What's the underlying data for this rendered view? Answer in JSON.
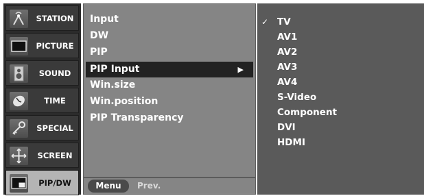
{
  "categories": [
    {
      "label": "STATION",
      "icon": "antenna-icon",
      "active": false
    },
    {
      "label": "PICTURE",
      "icon": "monitor-icon",
      "active": false
    },
    {
      "label": "SOUND",
      "icon": "speaker-icon",
      "active": false
    },
    {
      "label": "TIME",
      "icon": "clock-icon",
      "active": false
    },
    {
      "label": "SPECIAL",
      "icon": "key-icon",
      "active": false
    },
    {
      "label": "SCREEN",
      "icon": "screen-adjust-icon",
      "active": false
    },
    {
      "label": "PIP/DW",
      "icon": "pip-icon",
      "active": true
    }
  ],
  "submenu": {
    "items": [
      {
        "label": "Input",
        "selected": false
      },
      {
        "label": "DW",
        "selected": false
      },
      {
        "label": "PIP",
        "selected": false
      },
      {
        "label": "PIP Input",
        "selected": true,
        "arrow": "▶"
      },
      {
        "label": "Win.size",
        "selected": false
      },
      {
        "label": "Win.position",
        "selected": false
      },
      {
        "label": "PIP Transparency",
        "selected": false
      }
    ],
    "footer": {
      "menu_button": "Menu",
      "prev_label": "Prev."
    }
  },
  "options": {
    "items": [
      {
        "label": "TV",
        "checked": true,
        "check_mark": "✓"
      },
      {
        "label": "AV1",
        "checked": false
      },
      {
        "label": "AV2",
        "checked": false
      },
      {
        "label": "AV3",
        "checked": false
      },
      {
        "label": "AV4",
        "checked": false
      },
      {
        "label": "S-Video",
        "checked": false
      },
      {
        "label": "Component",
        "checked": false
      },
      {
        "label": "DVI",
        "checked": false
      },
      {
        "label": "HDMI",
        "checked": false
      }
    ]
  },
  "colors": {
    "panel_dark": "#2b2b2b",
    "category_active": "#b4b4b4",
    "submenu_bg": "#858585",
    "submenu_selected": "#222222",
    "options_bg": "#5a5a5a"
  }
}
